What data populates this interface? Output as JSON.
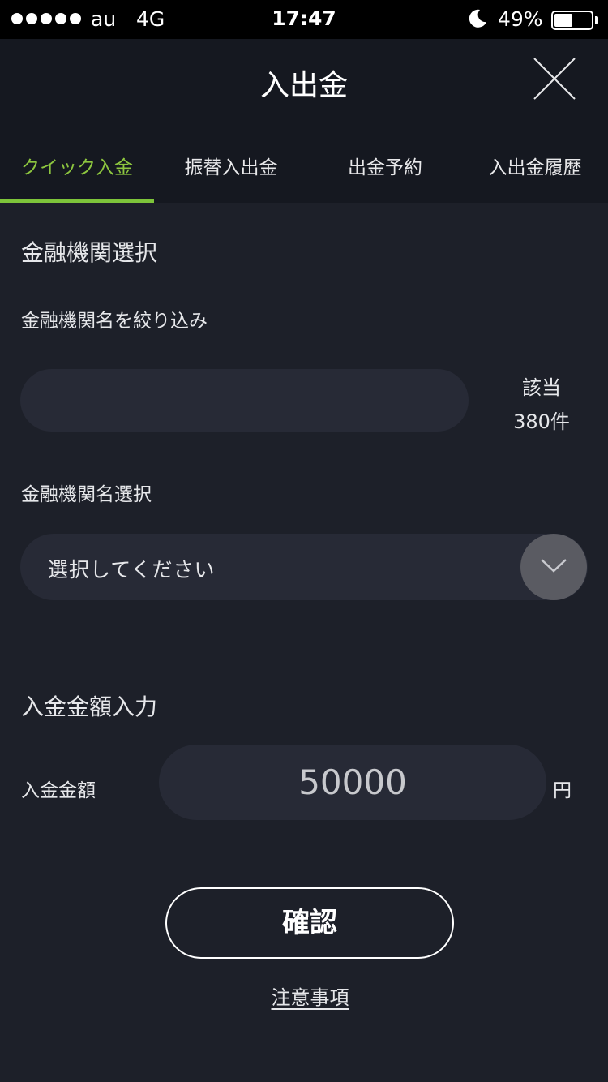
{
  "status_bar": {
    "carrier": "au",
    "network": "4G",
    "time": "17:47",
    "battery_text": "49%",
    "battery_level": 0.49,
    "icons": [
      "signal-dots-icon",
      "moon-icon",
      "battery-icon"
    ]
  },
  "header": {
    "title": "入出金",
    "close_icon": "close-icon"
  },
  "tabs": [
    {
      "label": "クイック入金",
      "active": true
    },
    {
      "label": "振替入出金",
      "active": false
    },
    {
      "label": "出金予約",
      "active": false
    },
    {
      "label": "入出金履歴",
      "active": false
    }
  ],
  "accent_color": "#7dc43a",
  "institution": {
    "section_title": "金融機関選択",
    "filter_label": "金融機関名を絞り込み",
    "filter_value": "",
    "count_label": "該当",
    "count_value": "380件",
    "select_label": "金融機関名選択",
    "select_placeholder": "選択してください",
    "select_icon": "chevron-down-icon"
  },
  "deposit": {
    "section_title": "入金金額入力",
    "amount_label": "入金金額",
    "amount_value": "50000",
    "currency": "円"
  },
  "actions": {
    "confirm_label": "確認",
    "notes_link": "注意事項"
  }
}
